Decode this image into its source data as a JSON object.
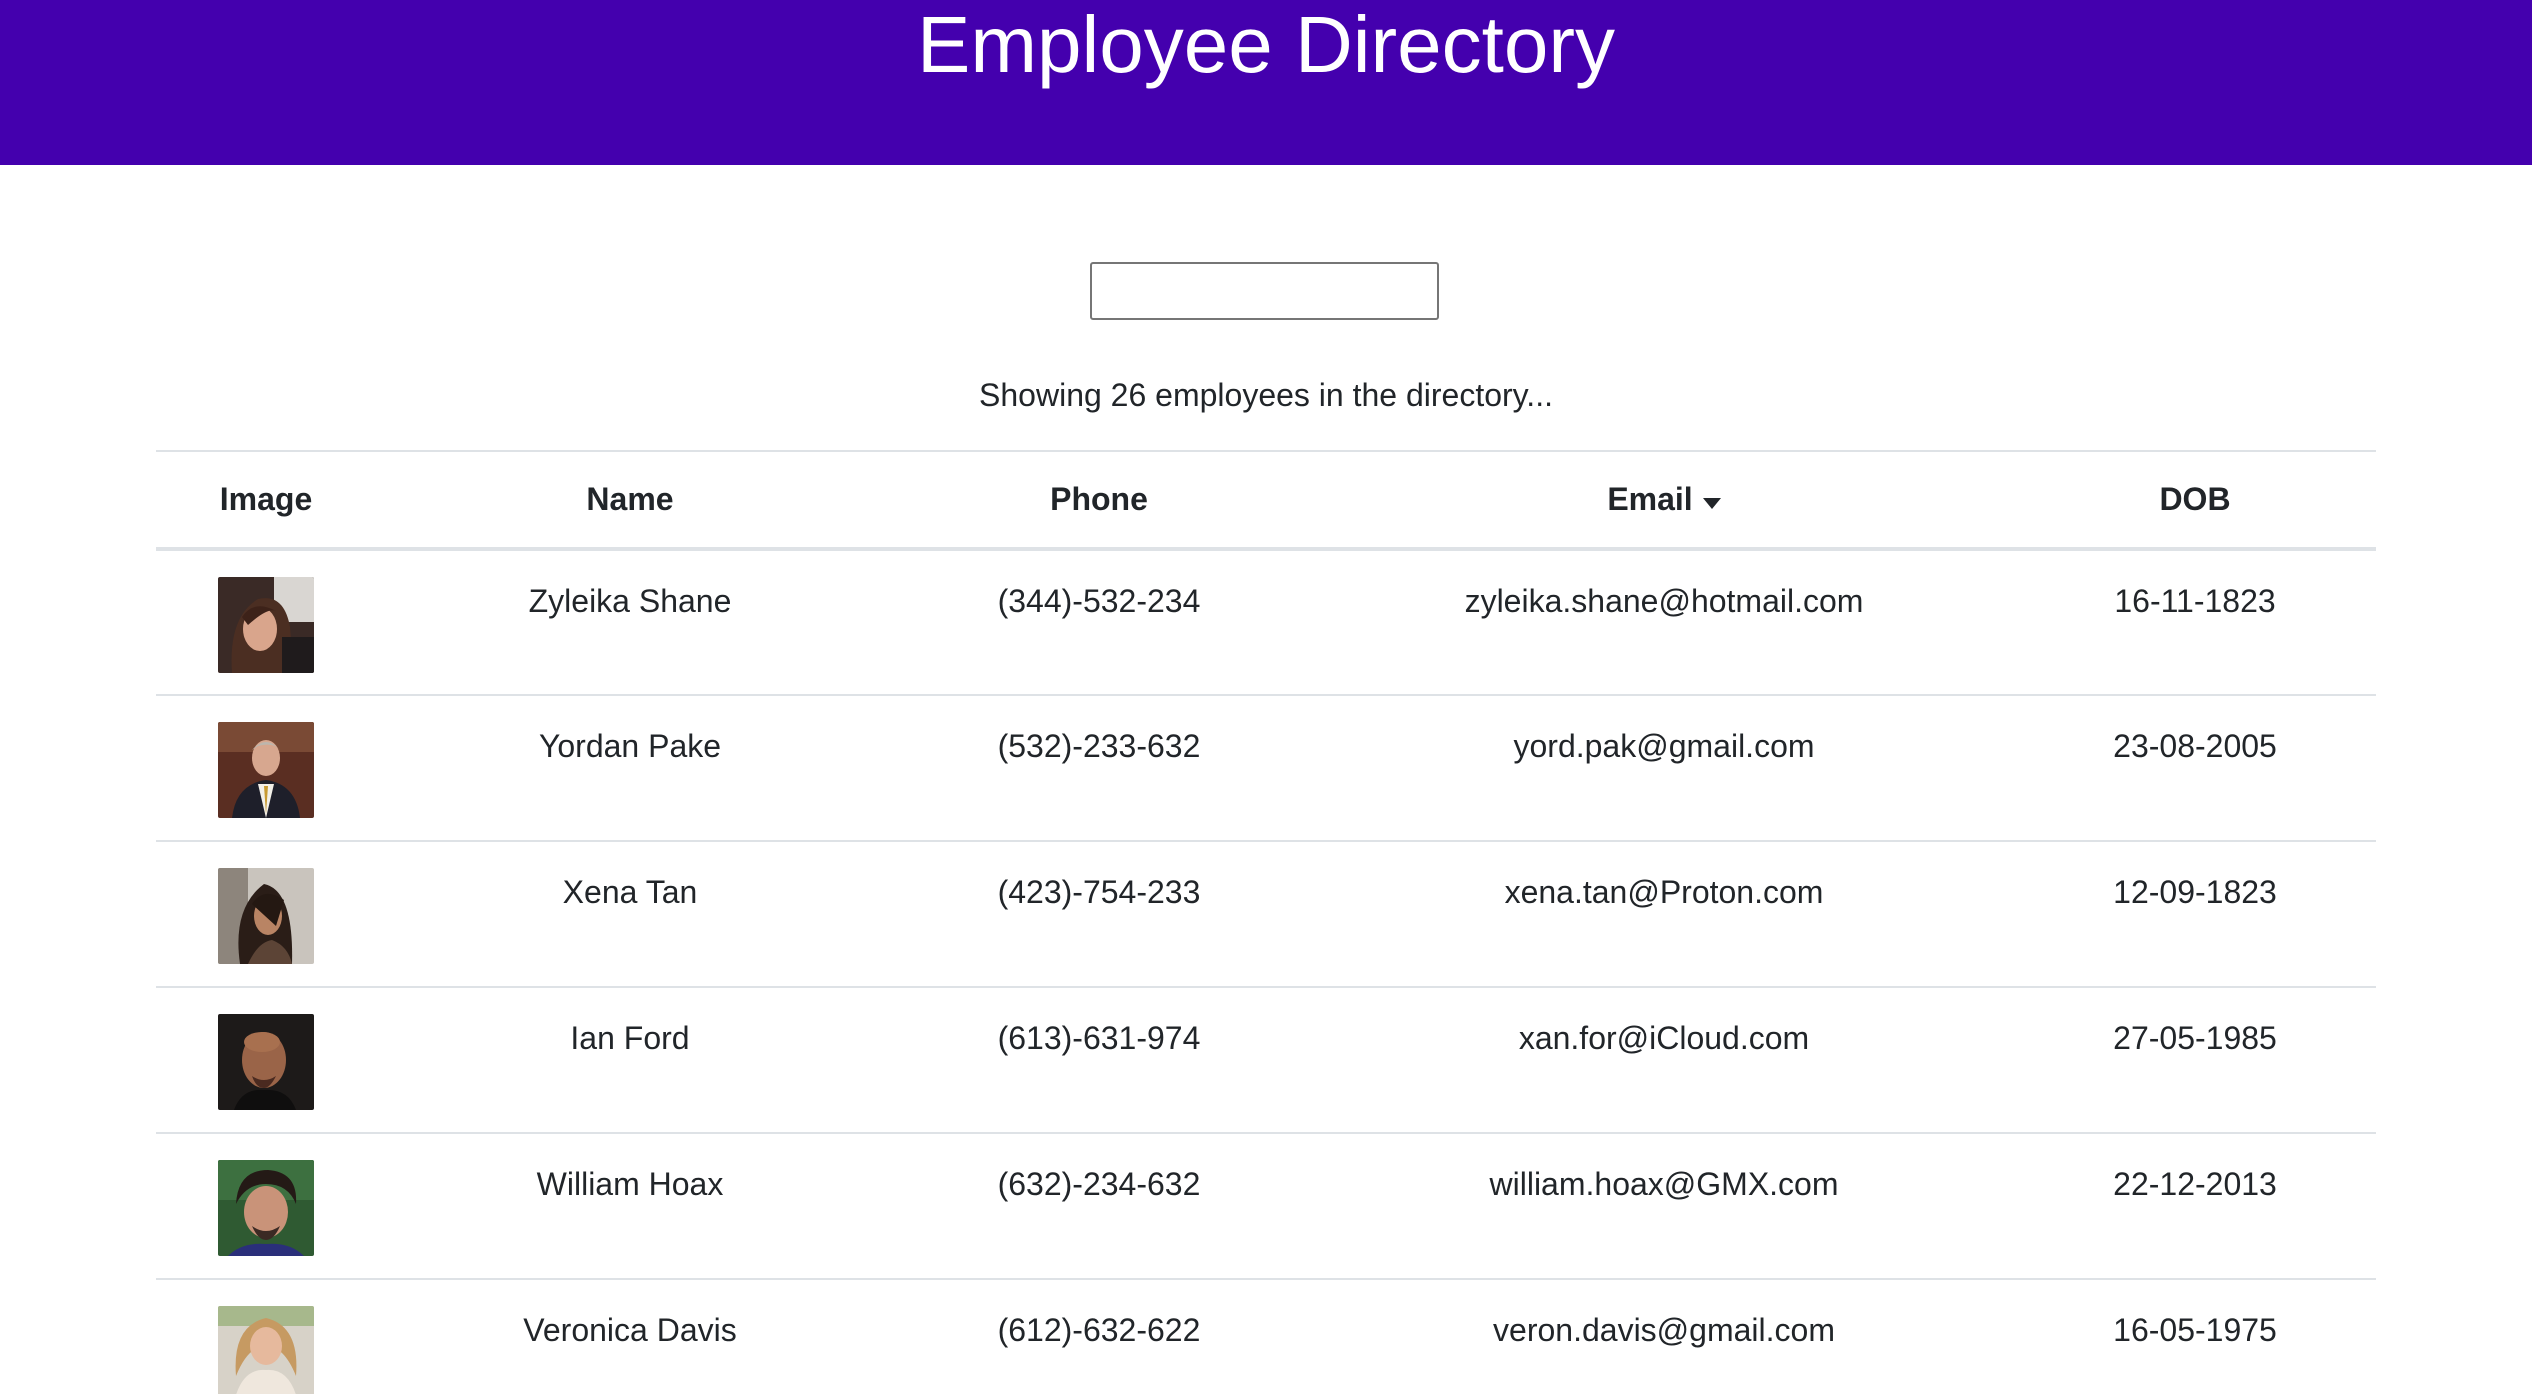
{
  "header": {
    "title": "Employee Directory"
  },
  "search": {
    "value": "",
    "placeholder": ""
  },
  "status": {
    "text": "Showing 26 employees in the directory..."
  },
  "table": {
    "columns": {
      "image": "Image",
      "name": "Name",
      "phone": "Phone",
      "email": "Email",
      "dob": "DOB"
    },
    "sorted_column": "email",
    "sort_direction": "descending",
    "rows": [
      {
        "name": "Zyleika Shane",
        "phone": "(344)-532-234",
        "email": "zyleika.shane@hotmail.com",
        "dob": "16-11-1823",
        "avatar": "photo-woman-long-hair"
      },
      {
        "name": "Yordan Pake",
        "phone": "(532)-233-632",
        "email": "yord.pak@gmail.com",
        "dob": "23-08-2005",
        "avatar": "photo-man-in-suit"
      },
      {
        "name": "Xena Tan",
        "phone": "(423)-754-233",
        "email": "xena.tan@Proton.com",
        "dob": "12-09-1823",
        "avatar": "photo-woman-dark-hair"
      },
      {
        "name": "Ian Ford",
        "phone": "(613)-631-974",
        "email": "xan.for@iCloud.com",
        "dob": "27-05-1985",
        "avatar": "photo-bald-man"
      },
      {
        "name": "William Hoax",
        "phone": "(632)-234-632",
        "email": "william.hoax@GMX.com",
        "dob": "22-12-2013",
        "avatar": "photo-young-man"
      },
      {
        "name": "Veronica Davis",
        "phone": "(612)-632-622",
        "email": "veron.davis@gmail.com",
        "dob": "16-05-1975",
        "avatar": "photo-blonde-woman"
      }
    ]
  },
  "colors": {
    "header_bg": "#4400ae",
    "header_text": "#ffffff",
    "text": "#212529",
    "border": "#dee2e6"
  }
}
